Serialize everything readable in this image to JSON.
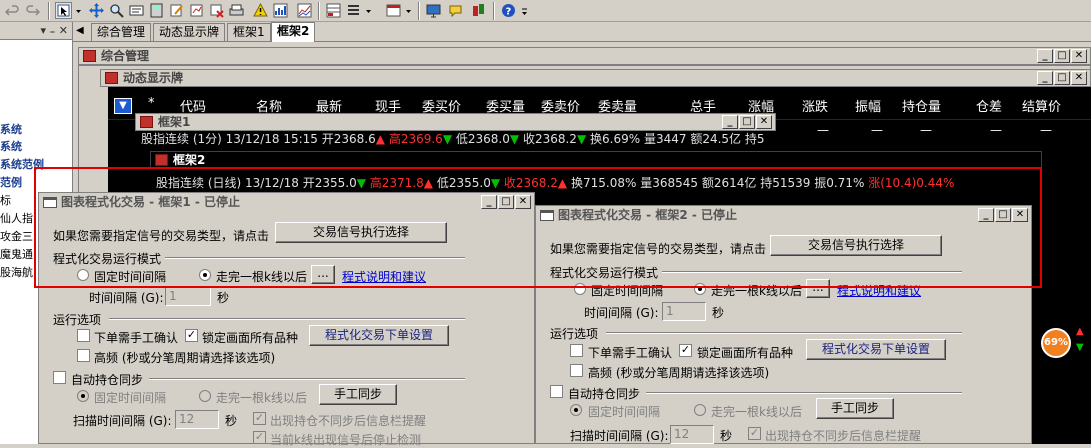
{
  "tabs": [
    "综合管理",
    "动态显示牌",
    "框架1",
    "框架2"
  ],
  "left_panel": {
    "items": [
      "系统",
      "系统",
      "系统范例",
      "范例",
      "标",
      "仙人指",
      "攻金三",
      "魔鬼通",
      "股海航"
    ]
  },
  "windows": {
    "overview": {
      "title": "综合管理"
    },
    "board": {
      "title": "动态显示牌",
      "columns": [
        "*",
        "代码",
        "名称",
        "最新",
        "现手",
        "委买价",
        "委买量",
        "委卖价",
        "委卖量",
        "总手",
        "涨幅",
        "涨跌",
        "振幅",
        "持仓量",
        "仓差",
        "结算价"
      ],
      "empty_cell": "—"
    },
    "frame1": {
      "title": "框架1",
      "quote": {
        "name": "股指连续 (1分) 13/12/18 15:15",
        "open": "开2368.6",
        "high": "高2369.6",
        "low": "低2368.0",
        "close": "收2368.2",
        "turnover": "换6.69%",
        "volume": "量3447",
        "amount": "额24.5亿",
        "position": "持5"
      }
    },
    "frame2": {
      "title": "框架2",
      "quote": {
        "name": "股指连续 (日线) 13/12/18",
        "open": "开2355.0",
        "high": "高2371.8",
        "low": "低2355.0",
        "close": "收2368.2",
        "turnover": "换715.08%",
        "volume": "量368545",
        "amount": "额2614亿",
        "position": "持51539",
        "amplitude": "振0.71%",
        "change": "涨(10.4)0.44%"
      }
    }
  },
  "dialogs": [
    {
      "title": "图表程式化交易 - 框架1 - 已停止",
      "prompt": "如果您需要指定信号的交易类型，请点击",
      "select_button": "交易信号执行选择",
      "mode_group": "程式化交易运行模式",
      "fixed_interval": "固定时间间隔",
      "after_k": "走完一根k线以后",
      "ellipsis": "...",
      "help_link": "程式说明和建议",
      "interval_label": "时间间隔 (G):",
      "interval_value": "1",
      "interval_unit": "秒",
      "run_group": "运行选项",
      "manual_confirm": "下单需手工确认",
      "lock_all": "锁定画面所有品种",
      "order_settings": "程式化交易下单设置",
      "high_freq": "高频 (秒或分笔周期请选择该选项)",
      "auto_sync": "自动持仓同步",
      "sync_fixed": "固定时间间隔",
      "sync_after_k": "走完一根k线以后",
      "manual_sync": "手工同步",
      "scan_label": "扫描时间间隔 (G):",
      "scan_value": "12",
      "scan_unit": "秒",
      "mismatch_alert": "出现持仓不同步后信息栏提醒",
      "stop_check": "当前k线出现信号后停止检测"
    },
    {
      "title": "图表程式化交易 - 框架2 - 已停止",
      "prompt": "如果您需要指定信号的交易类型，请点击",
      "select_button": "交易信号执行选择",
      "mode_group": "程式化交易运行模式",
      "fixed_interval": "固定时间间隔",
      "after_k": "走完一根k线以后",
      "ellipsis": "...",
      "help_link": "程式说明和建议",
      "interval_label": "时间间隔 (G):",
      "interval_value": "1",
      "interval_unit": "秒",
      "run_group": "运行选项",
      "manual_confirm": "下单需手工确认",
      "lock_all": "锁定画面所有品种",
      "order_settings": "程式化交易下单设置",
      "high_freq": "高频 (秒或分笔周期请选择该选项)",
      "auto_sync": "自动持仓同步",
      "sync_fixed": "固定时间间隔",
      "sync_after_k": "走完一根k线以后",
      "manual_sync": "手工同步",
      "scan_label": "扫描时间间隔 (G):",
      "scan_value": "12",
      "scan_unit": "秒",
      "mismatch_alert": "出现持仓不同步后信息栏提醒"
    }
  ],
  "badge": {
    "percent": "69%"
  },
  "colors": {
    "highlight": "#e00000",
    "down": "#00c000",
    "up": "#ff3030",
    "link": "#0000cc"
  }
}
